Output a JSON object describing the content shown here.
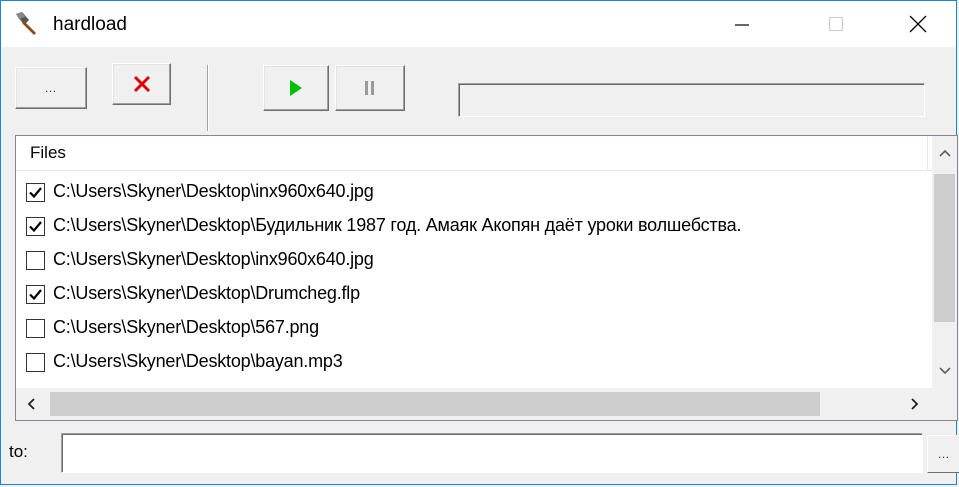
{
  "window": {
    "title": "hardload",
    "accent_color": "#1883d7"
  },
  "toolbar": {
    "browse_label": "…",
    "delete_icon": "red-x-icon",
    "play_icon": "green-play-icon",
    "pause_icon": "pause-icon",
    "progress_percent": 0
  },
  "list": {
    "header": "Files",
    "rows": [
      {
        "path": "C:\\Users\\Skyner\\Desktop\\inx960x640.jpg",
        "checked": true
      },
      {
        "path": "C:\\Users\\Skyner\\Desktop\\Будильник 1987 год. Амаяк Акопян даёт уроки волшебства.",
        "checked": true
      },
      {
        "path": "C:\\Users\\Skyner\\Desktop\\inx960x640.jpg",
        "checked": false
      },
      {
        "path": "C:\\Users\\Skyner\\Desktop\\Drumcheg.flp",
        "checked": true
      },
      {
        "path": "C:\\Users\\Skyner\\Desktop\\567.png",
        "checked": false
      },
      {
        "path": "C:\\Users\\Skyner\\Desktop\\bayan.mp3",
        "checked": false
      }
    ]
  },
  "bottom": {
    "to_label": "to:",
    "to_value": "",
    "browse_label": "…"
  }
}
